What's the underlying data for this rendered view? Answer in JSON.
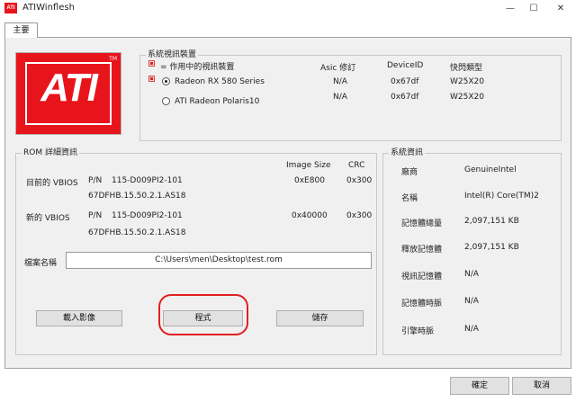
{
  "window": {
    "title": "ATIWinflesh",
    "icon_label": "ATI",
    "min_glyph": "—",
    "max_glyph": "☐",
    "close_glyph": "✕"
  },
  "tabs": [
    {
      "label": "主要"
    }
  ],
  "logo": {
    "text": "ATI",
    "tm": "TM",
    "accent_color": "#e8141c"
  },
  "device_group": {
    "title": "系統視訊裝置",
    "legend_text": "= 作用中的視訊裝置",
    "headers": {
      "asic": "Asic 修訂",
      "device_id": "DeviceID",
      "flash_type": "快閃類型"
    },
    "devices": [
      {
        "name": "Radeon RX 580 Series",
        "asic": "N/A",
        "device_id": "0x67df",
        "flash_type": "W25X20",
        "selected": true
      },
      {
        "name": "ATI Radeon Polaris10",
        "asic": "N/A",
        "device_id": "0x67df",
        "flash_type": "W25X20",
        "selected": false
      }
    ]
  },
  "rom_group": {
    "title": "ROM 詳細資訊",
    "headers": {
      "image_size": "Image Size",
      "crc": "CRC"
    },
    "current": {
      "label": "目前的 VBIOS",
      "pn_label": "P/N",
      "pn": "115-D009PI2-101",
      "version": "67DFHB.15.50.2.1.AS18",
      "image_size": "0xE800",
      "crc": "0x300"
    },
    "new": {
      "label": "新的 VBIOS",
      "pn_label": "P/N",
      "pn": "115-D009PI2-101",
      "version": "67DFHB.15.50.2.1.AS18",
      "image_size": "0x40000",
      "crc": "0x300"
    },
    "file_label": "檔案名稱",
    "file_value": "C:\\Users\\men\\Desktop\\test.rom",
    "buttons": {
      "load": "載入影像",
      "program": "程式",
      "save": "儲存"
    }
  },
  "system_group": {
    "title": "系統資訊",
    "rows": [
      {
        "label": "廠商",
        "value": "GenuineIntel"
      },
      {
        "label": "名稱",
        "value": "Intel(R) Core(TM)2"
      },
      {
        "label": "記憶體總量",
        "value": "2,097,151 KB"
      },
      {
        "label": "釋放記憶體",
        "value": "2,097,151 KB"
      },
      {
        "label": "視訊記憶體",
        "value": "N/A"
      },
      {
        "label": "記憶體時脈",
        "value": "N/A"
      },
      {
        "label": "引擎時脈",
        "value": "N/A"
      }
    ]
  },
  "footer": {
    "ok": "確定",
    "cancel": "取消"
  },
  "annotation": {
    "color": "#e02020"
  }
}
